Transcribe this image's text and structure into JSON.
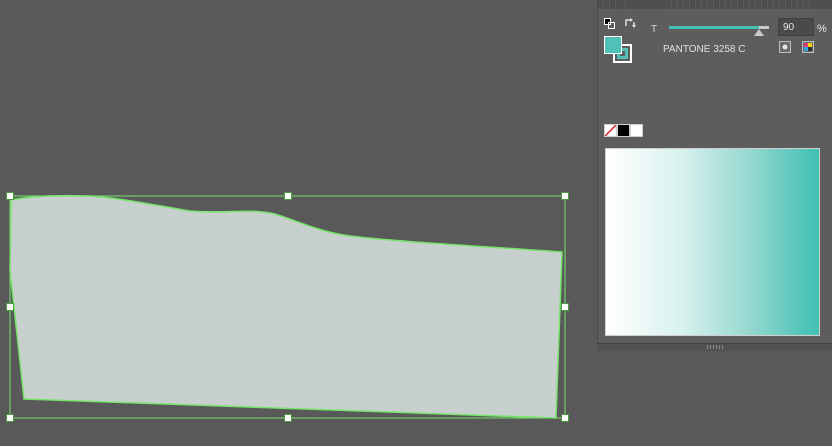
{
  "canvas": {
    "shape_fill_color": "#c8d0cd",
    "shape_stroke_color": "#77e36a",
    "selection_color": "#77e36a",
    "background_color": "#595959"
  },
  "color_panel": {
    "fill_color": "#4fc1b6",
    "tint_label": "T",
    "tint_value": "90",
    "tint_unit": "%",
    "tint_percent": 90,
    "swatch_name": "PANTONE 3258 C",
    "ramp_start_color": "#ffffff",
    "ramp_end_color": "#3fc0b2",
    "icons": [
      "swap-fill-stroke-icon",
      "default-colors-icon",
      "add-swatch-icon",
      "color-mode-icon",
      "none-icon",
      "black-icon",
      "white-icon"
    ]
  }
}
